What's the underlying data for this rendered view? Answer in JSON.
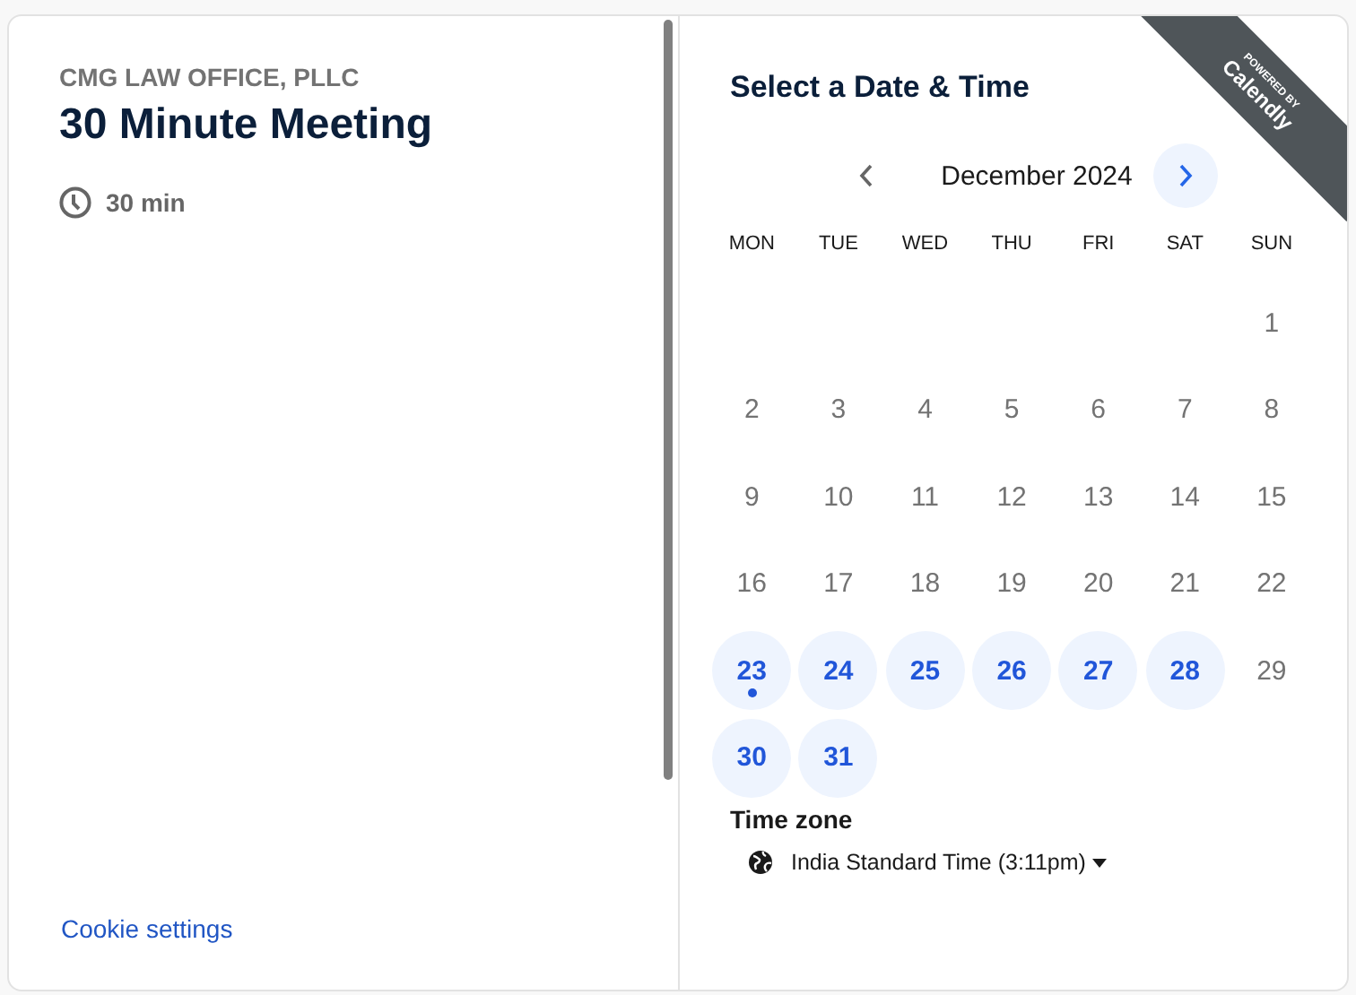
{
  "organizer": "CMG LAW OFFICE, PLLC",
  "event_title": "30 Minute Meeting",
  "duration": "30 min",
  "cookie_link": "Cookie settings",
  "ribbon": {
    "top": "POWERED BY",
    "brand": "Calendly"
  },
  "calendar": {
    "title": "Select a Date & Time",
    "month": "December 2024",
    "prev_disabled": true,
    "next_disabled": false,
    "weekdays": [
      "MON",
      "TUE",
      "WED",
      "THU",
      "FRI",
      "SAT",
      "SUN"
    ],
    "weeks": [
      [
        {
          "day": "1",
          "available": false,
          "today": false
        }
      ],
      [
        {
          "day": "2",
          "available": false,
          "today": false
        },
        {
          "day": "3",
          "available": false,
          "today": false
        },
        {
          "day": "4",
          "available": false,
          "today": false
        },
        {
          "day": "5",
          "available": false,
          "today": false
        },
        {
          "day": "6",
          "available": false,
          "today": false
        },
        {
          "day": "7",
          "available": false,
          "today": false
        },
        {
          "day": "8",
          "available": false,
          "today": false
        }
      ],
      [
        {
          "day": "9",
          "available": false,
          "today": false
        },
        {
          "day": "10",
          "available": false,
          "today": false
        },
        {
          "day": "11",
          "available": false,
          "today": false
        },
        {
          "day": "12",
          "available": false,
          "today": false
        },
        {
          "day": "13",
          "available": false,
          "today": false
        },
        {
          "day": "14",
          "available": false,
          "today": false
        },
        {
          "day": "15",
          "available": false,
          "today": false
        }
      ],
      [
        {
          "day": "16",
          "available": false,
          "today": false
        },
        {
          "day": "17",
          "available": false,
          "today": false
        },
        {
          "day": "18",
          "available": false,
          "today": false
        },
        {
          "day": "19",
          "available": false,
          "today": false
        },
        {
          "day": "20",
          "available": false,
          "today": false
        },
        {
          "day": "21",
          "available": false,
          "today": false
        },
        {
          "day": "22",
          "available": false,
          "today": false
        }
      ],
      [
        {
          "day": "23",
          "available": true,
          "today": true
        },
        {
          "day": "24",
          "available": true,
          "today": false
        },
        {
          "day": "25",
          "available": true,
          "today": false
        },
        {
          "day": "26",
          "available": true,
          "today": false
        },
        {
          "day": "27",
          "available": true,
          "today": false
        },
        {
          "day": "28",
          "available": true,
          "today": false
        },
        {
          "day": "29",
          "available": false,
          "today": false
        }
      ],
      [
        {
          "day": "30",
          "available": true,
          "today": false
        },
        {
          "day": "31",
          "available": true,
          "today": false
        }
      ]
    ]
  },
  "time_zone": {
    "label": "Time zone",
    "value": "India Standard Time (3:11pm)"
  }
}
